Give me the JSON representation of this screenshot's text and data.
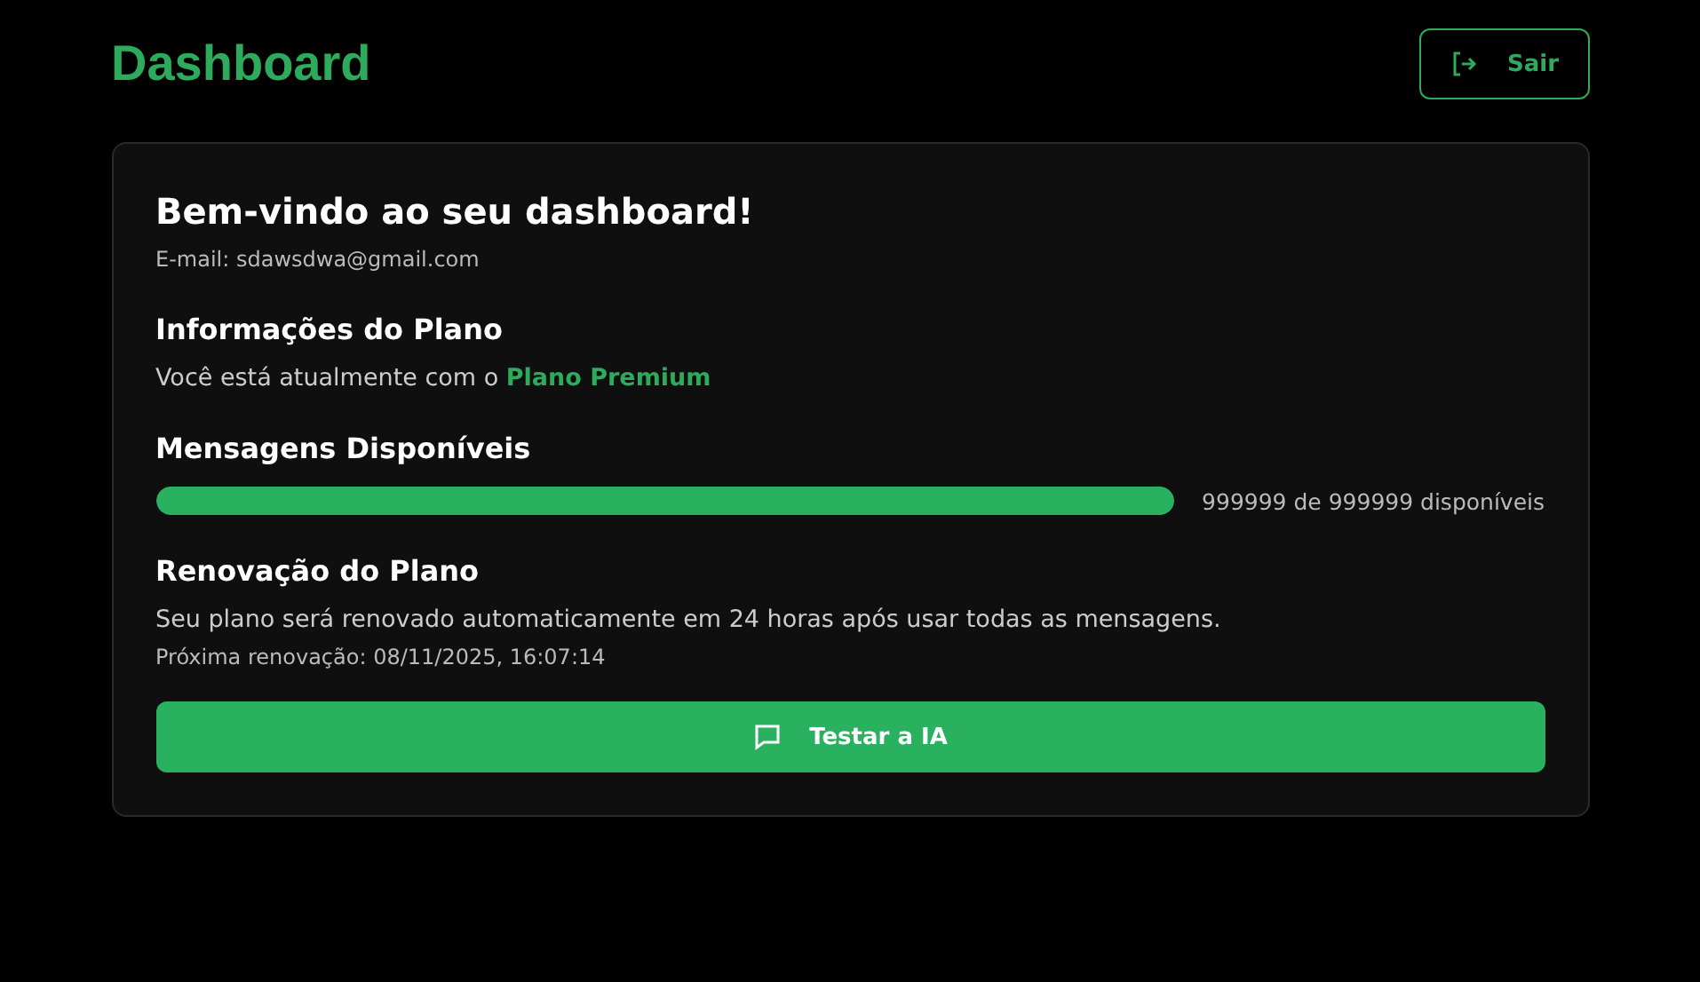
{
  "header": {
    "title": "Dashboard",
    "logout_button": "Sair"
  },
  "card": {
    "welcome": "Bem-vindo ao seu dashboard!",
    "email": "E-mail: sdawsdwa@gmail.com",
    "plan": {
      "heading": "Informações do Plano",
      "text": "Você está atualmente com o **Plano Premium**"
    },
    "messages": {
      "heading": "Mensagens Disponíveis",
      "level": 1,
      "reading": "999999 de 999999 disponíveis"
    },
    "renewal": {
      "heading": "Renovação do Plano",
      "text": "Seu plano será renovado automaticamente em 24 horas após usar todas as mensagens.",
      "next": "Próxima renovação: 08/11/2025, 16:07:14"
    },
    "action_button": "Testar a IA"
  }
}
